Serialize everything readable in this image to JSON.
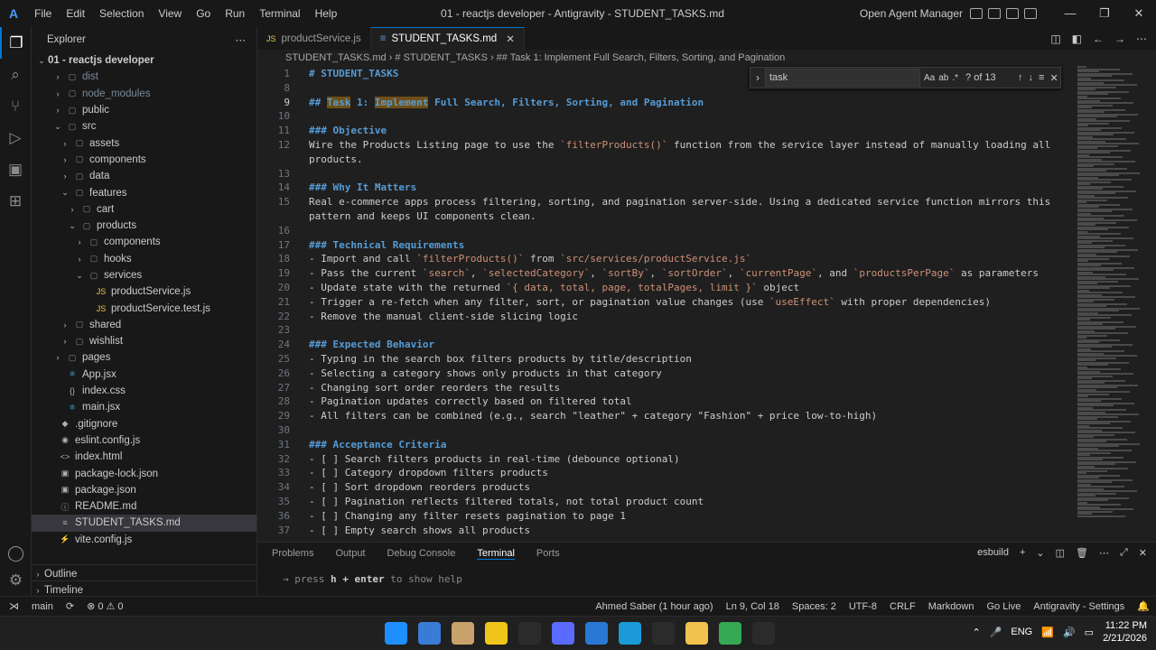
{
  "app": {
    "menu": [
      "File",
      "Edit",
      "Selection",
      "View",
      "Go",
      "Run",
      "Terminal",
      "Help"
    ],
    "window_title": "01 - reactjs developer - Antigravity - STUDENT_TASKS.md",
    "open_agent_manager": "Open Agent Manager"
  },
  "sidebar": {
    "title": "Explorer",
    "root": "01 - reactjs developer",
    "tree": [
      {
        "label": "dist",
        "depth": 1,
        "twisty": "›",
        "icon": "▢",
        "color": "#7a8a9a"
      },
      {
        "label": "node_modules",
        "depth": 1,
        "twisty": "›",
        "icon": "▢",
        "color": "#7a8a9a"
      },
      {
        "label": "public",
        "depth": 1,
        "twisty": "›",
        "icon": "▢",
        "color": "#cccccc"
      },
      {
        "label": "src",
        "depth": 1,
        "twisty": "⌄",
        "icon": "▢",
        "color": "#cccccc"
      },
      {
        "label": "assets",
        "depth": 2,
        "twisty": "›",
        "icon": "▢",
        "color": "#cccccc"
      },
      {
        "label": "components",
        "depth": 2,
        "twisty": "›",
        "icon": "▢",
        "color": "#cccccc"
      },
      {
        "label": "data",
        "depth": 2,
        "twisty": "›",
        "icon": "▢",
        "color": "#cccccc"
      },
      {
        "label": "features",
        "depth": 2,
        "twisty": "⌄",
        "icon": "▢",
        "color": "#cccccc"
      },
      {
        "label": "cart",
        "depth": 3,
        "twisty": "›",
        "icon": "▢",
        "color": "#cccccc"
      },
      {
        "label": "products",
        "depth": 3,
        "twisty": "⌄",
        "icon": "▢",
        "color": "#cccccc"
      },
      {
        "label": "components",
        "depth": 4,
        "twisty": "›",
        "icon": "▢",
        "color": "#cccccc"
      },
      {
        "label": "hooks",
        "depth": 4,
        "twisty": "›",
        "icon": "▢",
        "color": "#cccccc"
      },
      {
        "label": "services",
        "depth": 4,
        "twisty": "⌄",
        "icon": "▢",
        "color": "#cccccc"
      },
      {
        "label": "productService.js",
        "depth": 5,
        "twisty": "",
        "icon": "JS",
        "color": "#cccccc"
      },
      {
        "label": "productService.test.js",
        "depth": 5,
        "twisty": "",
        "icon": "JS",
        "color": "#cccccc"
      },
      {
        "label": "shared",
        "depth": 2,
        "twisty": "›",
        "icon": "▢",
        "color": "#cccccc"
      },
      {
        "label": "wishlist",
        "depth": 2,
        "twisty": "›",
        "icon": "▢",
        "color": "#cccccc"
      },
      {
        "label": "pages",
        "depth": 1,
        "twisty": "›",
        "icon": "▢",
        "color": "#cccccc"
      },
      {
        "label": "App.jsx",
        "depth": 1,
        "twisty": "",
        "icon": "⚛",
        "color": "#cccccc"
      },
      {
        "label": "index.css",
        "depth": 1,
        "twisty": "",
        "icon": "{}",
        "color": "#cccccc"
      },
      {
        "label": "main.jsx",
        "depth": 1,
        "twisty": "",
        "icon": "⚛",
        "color": "#cccccc"
      },
      {
        "label": ".gitignore",
        "depth": 0,
        "twisty": "",
        "icon": "◆",
        "color": "#cccccc"
      },
      {
        "label": "eslint.config.js",
        "depth": 0,
        "twisty": "",
        "icon": "◉",
        "color": "#cccccc"
      },
      {
        "label": "index.html",
        "depth": 0,
        "twisty": "",
        "icon": "<>",
        "color": "#cccccc"
      },
      {
        "label": "package-lock.json",
        "depth": 0,
        "twisty": "",
        "icon": "▣",
        "color": "#cccccc"
      },
      {
        "label": "package.json",
        "depth": 0,
        "twisty": "",
        "icon": "▣",
        "color": "#cccccc"
      },
      {
        "label": "README.md",
        "depth": 0,
        "twisty": "",
        "icon": "ⓘ",
        "color": "#cccccc"
      },
      {
        "label": "STUDENT_TASKS.md",
        "depth": 0,
        "twisty": "",
        "icon": "≡",
        "color": "#cccccc",
        "selected": true
      },
      {
        "label": "vite.config.js",
        "depth": 0,
        "twisty": "",
        "icon": "⚡",
        "color": "#cccccc"
      }
    ],
    "outline": "Outline",
    "timeline": "Timeline"
  },
  "tabs": [
    {
      "label": "productService.js",
      "icon": "JS",
      "active": false
    },
    {
      "label": "STUDENT_TASKS.md",
      "icon": "≡",
      "active": true
    }
  ],
  "breadcrumb": "STUDENT_TASKS.md  ›  # STUDENT_TASKS  ›  ## Task 1: Implement Full Search, Filters, Sorting, and Pagination",
  "find": {
    "value": "task",
    "count": "? of 13",
    "case_label": "Aa",
    "word_label": "ab",
    "regex_label": ".*"
  },
  "editor": {
    "lines": [
      {
        "n": "1",
        "parts": [
          [
            "h",
            "# STUDENT_TASKS"
          ]
        ]
      },
      {
        "n": "8",
        "parts": []
      },
      {
        "n": "9",
        "parts": [
          [
            "h",
            "## "
          ],
          [
            "h match",
            "Task"
          ],
          [
            "h",
            " 1: "
          ],
          [
            "h match",
            "Implement"
          ],
          [
            "h",
            " Full Search, Filters, Sorting, and Pagination"
          ]
        ]
      },
      {
        "n": "10",
        "parts": []
      },
      {
        "n": "11",
        "parts": [
          [
            "h",
            "### Objective"
          ]
        ]
      },
      {
        "n": "12",
        "parts": [
          [
            "plain",
            "Wire the Products Listing page to use the "
          ],
          [
            "code",
            "`filterProducts()`"
          ],
          [
            "plain",
            " function from the service layer instead of manually loading all"
          ]
        ]
      },
      {
        "n": "",
        "parts": [
          [
            "plain",
            "products."
          ]
        ]
      },
      {
        "n": "13",
        "parts": []
      },
      {
        "n": "14",
        "parts": [
          [
            "h",
            "### Why It Matters"
          ]
        ]
      },
      {
        "n": "15",
        "parts": [
          [
            "plain",
            "Real e-commerce apps process filtering, sorting, and pagination server-side. Using a dedicated service function mirrors this"
          ]
        ]
      },
      {
        "n": "",
        "parts": [
          [
            "plain",
            "pattern and keeps UI components clean."
          ]
        ]
      },
      {
        "n": "16",
        "parts": []
      },
      {
        "n": "17",
        "parts": [
          [
            "h",
            "### Technical Requirements"
          ]
        ]
      },
      {
        "n": "18",
        "parts": [
          [
            "plain",
            "- Import and call "
          ],
          [
            "code",
            "`filterProducts()`"
          ],
          [
            "plain",
            " from "
          ],
          [
            "code",
            "`src/services/productService.js`"
          ]
        ]
      },
      {
        "n": "19",
        "parts": [
          [
            "plain",
            "- Pass the current "
          ],
          [
            "code",
            "`search`"
          ],
          [
            "plain",
            ", "
          ],
          [
            "code",
            "`selectedCategory`"
          ],
          [
            "plain",
            ", "
          ],
          [
            "code",
            "`sortBy`"
          ],
          [
            "plain",
            ", "
          ],
          [
            "code",
            "`sortOrder`"
          ],
          [
            "plain",
            ", "
          ],
          [
            "code",
            "`currentPage`"
          ],
          [
            "plain",
            ", and "
          ],
          [
            "code",
            "`productsPerPage`"
          ],
          [
            "plain",
            " as parameters"
          ]
        ]
      },
      {
        "n": "20",
        "parts": [
          [
            "plain",
            "- Update state with the returned "
          ],
          [
            "code",
            "`{ data, total, page, totalPages, limit }`"
          ],
          [
            "plain",
            " object"
          ]
        ]
      },
      {
        "n": "21",
        "parts": [
          [
            "plain",
            "- Trigger a re-fetch when any filter, sort, or pagination value changes (use "
          ],
          [
            "code",
            "`useEffect`"
          ],
          [
            "plain",
            " with proper dependencies)"
          ]
        ]
      },
      {
        "n": "22",
        "parts": [
          [
            "plain",
            "- Remove the manual client-side slicing logic"
          ]
        ]
      },
      {
        "n": "23",
        "parts": []
      },
      {
        "n": "24",
        "parts": [
          [
            "h",
            "### Expected Behavior"
          ]
        ]
      },
      {
        "n": "25",
        "parts": [
          [
            "plain",
            "- Typing in the search box filters products by title/description"
          ]
        ]
      },
      {
        "n": "26",
        "parts": [
          [
            "plain",
            "- Selecting a category shows only products in that category"
          ]
        ]
      },
      {
        "n": "27",
        "parts": [
          [
            "plain",
            "- Changing sort order reorders the results"
          ]
        ]
      },
      {
        "n": "28",
        "parts": [
          [
            "plain",
            "- Pagination updates correctly based on filtered total"
          ]
        ]
      },
      {
        "n": "29",
        "parts": [
          [
            "plain",
            "- All filters can be combined (e.g., search \"leather\" + category \"Fashion\" + price low-to-high)"
          ]
        ]
      },
      {
        "n": "30",
        "parts": []
      },
      {
        "n": "31",
        "parts": [
          [
            "h",
            "### Acceptance Criteria"
          ]
        ]
      },
      {
        "n": "32",
        "parts": [
          [
            "plain",
            "- [ ] Search filters products in real-time (debounce optional)"
          ]
        ]
      },
      {
        "n": "33",
        "parts": [
          [
            "plain",
            "- [ ] Category dropdown filters products"
          ]
        ]
      },
      {
        "n": "34",
        "parts": [
          [
            "plain",
            "- [ ] Sort dropdown reorders products"
          ]
        ]
      },
      {
        "n": "35",
        "parts": [
          [
            "plain",
            "- [ ] Pagination reflects filtered totals, not total product count"
          ]
        ]
      },
      {
        "n": "36",
        "parts": [
          [
            "plain",
            "- [ ] Changing any filter resets pagination to page 1"
          ]
        ]
      },
      {
        "n": "37",
        "parts": [
          [
            "plain",
            "- [ ] Empty search shows all products"
          ]
        ]
      }
    ]
  },
  "panel": {
    "tabs": [
      "Problems",
      "Output",
      "Debug Console",
      "Terminal",
      "Ports"
    ],
    "active": "Terminal",
    "task": "esbuild",
    "terminal_line_prefix": "→  press ",
    "terminal_key": "h + enter",
    "terminal_suffix": " to show help"
  },
  "status": {
    "branch": "main",
    "problems": "⊗ 0 ⚠ 0",
    "blame": "Ahmed Saber (1 hour ago)",
    "cursor": "Ln 9, Col 18",
    "spaces": "Spaces: 2",
    "encoding": "UTF-8",
    "eol": "CRLF",
    "language": "Markdown",
    "golive": "Go Live",
    "settings": "Antigravity - Settings"
  },
  "taskbar": {
    "lang": "ENG",
    "time": "11:22 PM",
    "date": "2/21/2026",
    "icon_colors": [
      "#1f8fff",
      "#3a7bd5",
      "#c9a26b",
      "#f0c419",
      "#2b2b2b",
      "#5b6bff",
      "#2a78d6",
      "#1a9bd7",
      "#2b2b2b",
      "#f2c14e",
      "#34a853",
      "#2b2b2b"
    ]
  }
}
